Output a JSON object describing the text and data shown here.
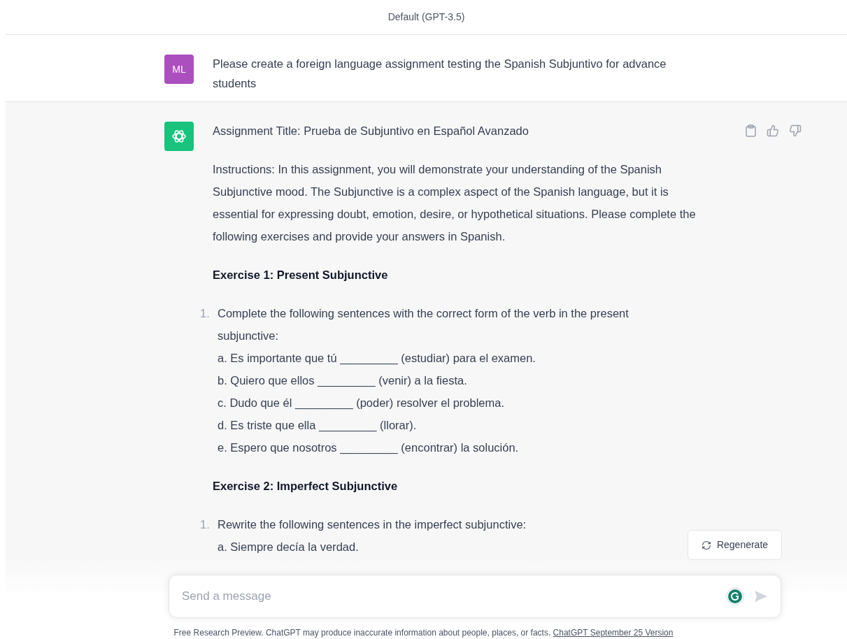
{
  "header": {
    "title": "Default (GPT-3.5)"
  },
  "messages": [
    {
      "kind": "user",
      "avatar": "ML",
      "color": "#ab4fbf",
      "blocks": [
        {
          "kind": "paragraph",
          "text": "Please create a foreign language assignment testing the Spanish Subjuntivo for advance students"
        }
      ]
    },
    {
      "kind": "assistant",
      "color": "#19c37d",
      "blocks": [
        {
          "kind": "paragraph",
          "text": "Assignment Title: Prueba de Subjuntivo en Español Avanzado"
        },
        {
          "kind": "paragraph",
          "text": "Instructions: In this assignment, you will demonstrate your understanding of the Spanish Subjunctive mood. The Subjunctive is a complex aspect of the Spanish language, but it is essential for expressing doubt, emotion, desire, or hypothetical situations. Please complete the following exercises and provide your answers in Spanish."
        },
        {
          "kind": "heading",
          "text": "Exercise 1: Present Subjunctive"
        },
        {
          "kind": "list_item",
          "number": "1.",
          "text": "Complete the following sentences with the correct form of the verb in the present subjunctive:",
          "lines": [
            "a. Es importante que tú _________ (estudiar) para el examen.",
            "b. Quiero que ellos _________ (venir) a la fiesta.",
            "c. Dudo que él _________ (poder) resolver el problema.",
            "d. Es triste que ella _________ (llorar).",
            "e. Espero que nosotros _________ (encontrar) la solución."
          ]
        },
        {
          "kind": "heading",
          "text": "Exercise 2: Imperfect Subjunctive"
        },
        {
          "kind": "list_item",
          "number": "1.",
          "text": "Rewrite the following sentences in the imperfect subjunctive:",
          "lines": [
            "a. Siempre decía la verdad."
          ]
        }
      ]
    }
  ],
  "regenerate_button": "Regenerate",
  "composer": {
    "placeholder": "Send a message"
  },
  "footer": {
    "text": "Free Research Preview. ChatGPT may produce inaccurate information about people, places, or facts.",
    "link": "ChatGPT September 25 Version"
  }
}
